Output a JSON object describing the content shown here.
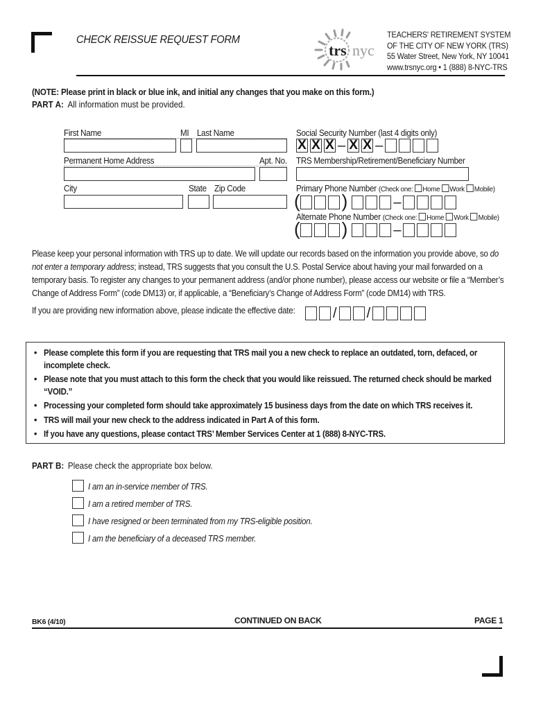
{
  "header": {
    "form_title": "CHECK REISSUE REQUEST FORM",
    "logo": {
      "bold": "trs",
      "light": "nyc",
      "icon": "sun-logo-icon"
    },
    "org_lines": [
      "TEACHERS' RETIREMENT SYSTEM",
      "OF THE CITY OF NEW YORK (TRS)",
      "55 Water Street, New York, NY 10041",
      "www.trsnyc.org • 1 (888) 8-NYC-TRS"
    ]
  },
  "note": "(NOTE: Please print in black or blue ink, and initial any changes that you make on this form.)",
  "part_a": {
    "label": "PART A:",
    "text": "All information must be provided.",
    "fields": {
      "first_name": {
        "label": "First Name",
        "value": ""
      },
      "mi": {
        "label": "MI",
        "value": ""
      },
      "last_name": {
        "label": "Last Name",
        "value": ""
      },
      "address": {
        "label": "Permanent Home Address",
        "value": ""
      },
      "apt": {
        "label": "Apt. No.",
        "value": ""
      },
      "city": {
        "label": "City",
        "value": ""
      },
      "state": {
        "label": "State",
        "value": ""
      },
      "zip": {
        "label": "Zip Code",
        "value": ""
      },
      "ssn": {
        "label": "Social Security Number (last 4 digits only)",
        "masked": [
          "X",
          "X",
          "X",
          "X",
          "X"
        ],
        "last4": [
          "",
          "",
          "",
          ""
        ]
      },
      "trs_number": {
        "label": "TRS Membership/Retirement/Beneficiary Number",
        "value": ""
      },
      "primary_phone": {
        "label": "Primary Phone Number",
        "check_prefix": "(Check one:",
        "options": [
          "Home",
          "Work",
          "Mobile)"
        ]
      },
      "alternate_phone": {
        "label": "Alternate Phone Number",
        "check_prefix": "(Check one:",
        "options": [
          "Home",
          "Work",
          "Mobile)"
        ]
      }
    }
  },
  "info_paragraph": {
    "part1": "Please keep your personal information with TRS up to date. We will update our records based on the information you provide above, so ",
    "italic": "do not enter a temporary address",
    "part2": "; instead, TRS suggests that you consult the U.S. Postal Service about having your mail forwarded on a temporary basis. To register any changes to your permanent address (and/or phone number), please access our website or file a “Member’s Change of Address Form” (code DM13) or, if applicable, a “Beneficiary’s Change of Address Form” (code DM14) with TRS."
  },
  "effective_date": {
    "label": "If you are providing new information above, please indicate the effective date:",
    "separator": "/"
  },
  "bullets": [
    "Please complete this form if you are requesting that TRS mail you a new check to replace an outdated, torn, defaced, or incomplete check.",
    "Please note that you must attach to this form the check that you would like reissued.  The returned check should be marked “VOID.”",
    "Processing your completed form should take approximately 15 business days from the date on which TRS receives it.",
    "TRS will mail your new check to the address indicated in Part A of this form.",
    "If you have any questions, please contact TRS’ Member Services Center at 1 (888) 8-NYC-TRS."
  ],
  "part_b": {
    "label": "PART B:",
    "text": "Please check the appropriate box below.",
    "options": [
      "I am an in-service member of TRS.",
      "I am a retired member of TRS.",
      "I have resigned or been terminated from my TRS-eligible position.",
      "I am the beneficiary of a deceased TRS member."
    ]
  },
  "footer": {
    "form_code": "BK6 (4/10)",
    "continued": "CONTINUED ON BACK",
    "page": "PAGE 1"
  }
}
